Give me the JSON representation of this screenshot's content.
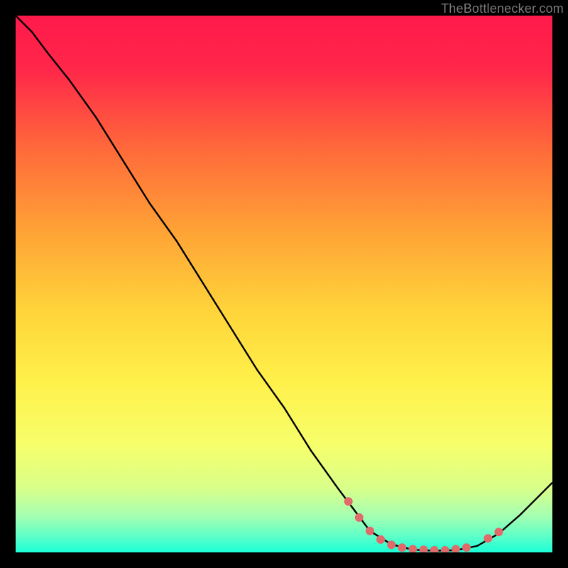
{
  "watermark": "TheBottlenecker.com",
  "chart_data": {
    "type": "line",
    "title": "",
    "xlabel": "",
    "ylabel": "",
    "xlim": [
      0,
      100
    ],
    "ylim": [
      0,
      100
    ],
    "grid": false,
    "background": {
      "type": "vertical-gradient",
      "stops": [
        {
          "offset": 0.0,
          "color": "#ff1a4b"
        },
        {
          "offset": 0.1,
          "color": "#ff274a"
        },
        {
          "offset": 0.25,
          "color": "#ff6a3a"
        },
        {
          "offset": 0.4,
          "color": "#ffa236"
        },
        {
          "offset": 0.55,
          "color": "#ffd43a"
        },
        {
          "offset": 0.68,
          "color": "#fff04a"
        },
        {
          "offset": 0.8,
          "color": "#f6ff6a"
        },
        {
          "offset": 0.88,
          "color": "#d9ff8a"
        },
        {
          "offset": 0.93,
          "color": "#a8ffb0"
        },
        {
          "offset": 0.97,
          "color": "#5effc8"
        },
        {
          "offset": 1.0,
          "color": "#1affd6"
        }
      ]
    },
    "series": [
      {
        "name": "bottleneck-curve",
        "color": "#000000",
        "points": [
          {
            "x": 0,
            "y": 100
          },
          {
            "x": 3,
            "y": 97
          },
          {
            "x": 6,
            "y": 93
          },
          {
            "x": 10,
            "y": 88
          },
          {
            "x": 15,
            "y": 81
          },
          {
            "x": 20,
            "y": 73
          },
          {
            "x": 25,
            "y": 65
          },
          {
            "x": 30,
            "y": 58
          },
          {
            "x": 35,
            "y": 50
          },
          {
            "x": 40,
            "y": 42
          },
          {
            "x": 45,
            "y": 34
          },
          {
            "x": 50,
            "y": 27
          },
          {
            "x": 55,
            "y": 19
          },
          {
            "x": 60,
            "y": 12
          },
          {
            "x": 63,
            "y": 8
          },
          {
            "x": 66,
            "y": 4
          },
          {
            "x": 70,
            "y": 1.5
          },
          {
            "x": 74,
            "y": 0.5
          },
          {
            "x": 78,
            "y": 0.3
          },
          {
            "x": 82,
            "y": 0.4
          },
          {
            "x": 86,
            "y": 1.2
          },
          {
            "x": 90,
            "y": 3.5
          },
          {
            "x": 94,
            "y": 7
          },
          {
            "x": 98,
            "y": 11
          },
          {
            "x": 100,
            "y": 13
          }
        ]
      }
    ],
    "markers": {
      "name": "sweet-spot-dots",
      "color": "#e16a6a",
      "radius": 6,
      "points": [
        {
          "x": 62,
          "y": 9.5
        },
        {
          "x": 64,
          "y": 6.5
        },
        {
          "x": 66,
          "y": 4.0
        },
        {
          "x": 68,
          "y": 2.4
        },
        {
          "x": 70,
          "y": 1.4
        },
        {
          "x": 72,
          "y": 0.9
        },
        {
          "x": 74,
          "y": 0.6
        },
        {
          "x": 76,
          "y": 0.5
        },
        {
          "x": 78,
          "y": 0.4
        },
        {
          "x": 80,
          "y": 0.4
        },
        {
          "x": 82,
          "y": 0.6
        },
        {
          "x": 84,
          "y": 0.9
        },
        {
          "x": 88,
          "y": 2.6
        },
        {
          "x": 90,
          "y": 3.8
        }
      ]
    }
  }
}
